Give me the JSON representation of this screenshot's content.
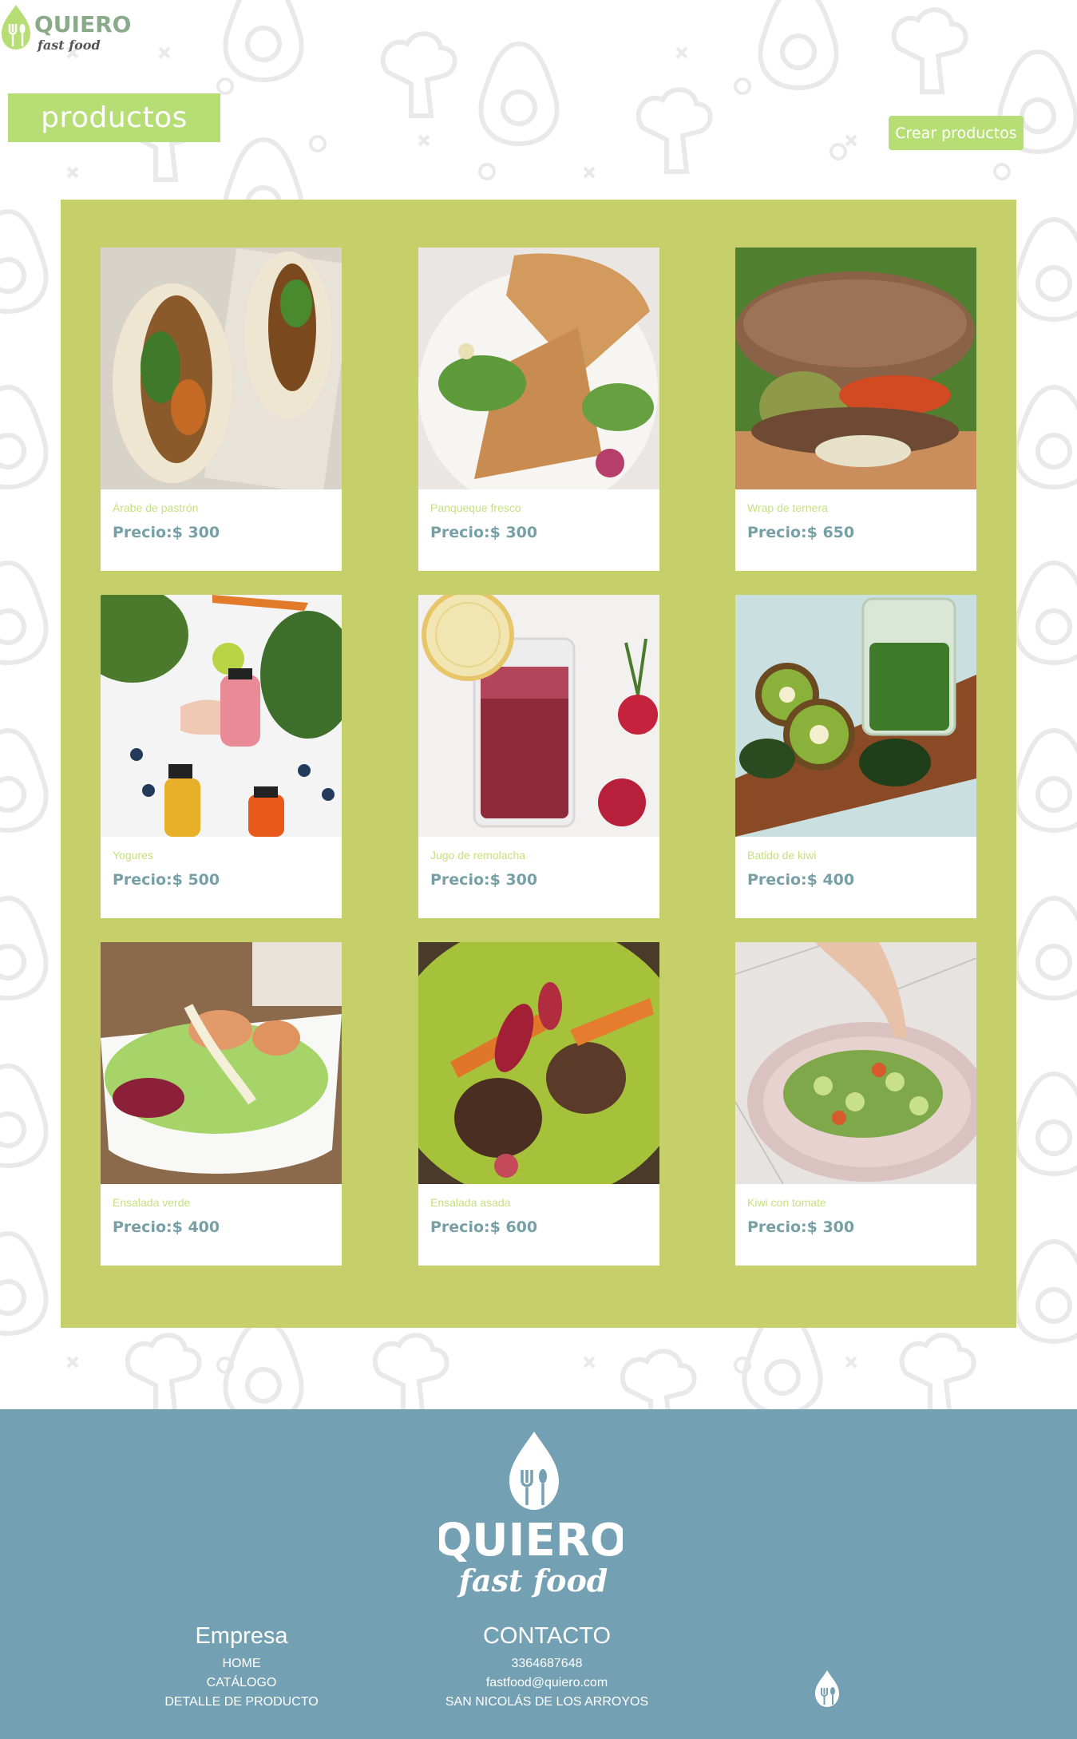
{
  "brand": {
    "name": "QUIERO",
    "tagline": "fast food"
  },
  "page": {
    "title": "productos",
    "create_button": "Crear productos"
  },
  "products": [
    {
      "name": "Árabe de pastrón",
      "price": "Precio:$ 300",
      "image": "sandwich-pita-photo"
    },
    {
      "name": "Panqueque fresco",
      "price": "Precio:$ 300",
      "image": "crepe-salad-photo"
    },
    {
      "name": "Wrap de ternera",
      "price": "Precio:$ 650",
      "image": "burger-photo"
    },
    {
      "name": "Yogures",
      "price": "Precio:$ 500",
      "image": "juice-bottles-photo"
    },
    {
      "name": "Jugo de remolacha",
      "price": "Precio:$ 300",
      "image": "beet-juice-photo"
    },
    {
      "name": "Batido de kiwi",
      "price": "Precio:$ 400",
      "image": "kiwi-smoothie-photo"
    },
    {
      "name": "Ensalada verde",
      "price": "Precio:$ 400",
      "image": "green-salad-photo"
    },
    {
      "name": "Ensalada asada",
      "price": "Precio:$ 600",
      "image": "grilled-salad-photo"
    },
    {
      "name": "Kiwi con tomate",
      "price": "Precio:$ 300",
      "image": "cucumber-salad-photo"
    }
  ],
  "footer": {
    "logo_name": "QUIERO",
    "logo_tagline": "fast food",
    "empresa": {
      "heading": "Empresa",
      "links": [
        "HOME",
        "CATÁLOGO",
        "DETALLE DE PRODUCTO"
      ]
    },
    "contacto": {
      "heading": "CONTACTO",
      "lines": [
        "3364687648",
        "fastfood@quiero.com",
        "SAN NICOLÁS DE LOS ARROYOS"
      ]
    }
  },
  "colors": {
    "accent_green": "#b7de74",
    "panel_green": "#c5d06b",
    "footer_blue": "#74a0b3",
    "price_text": "#77a0a6",
    "name_text": "#c6e07f"
  }
}
